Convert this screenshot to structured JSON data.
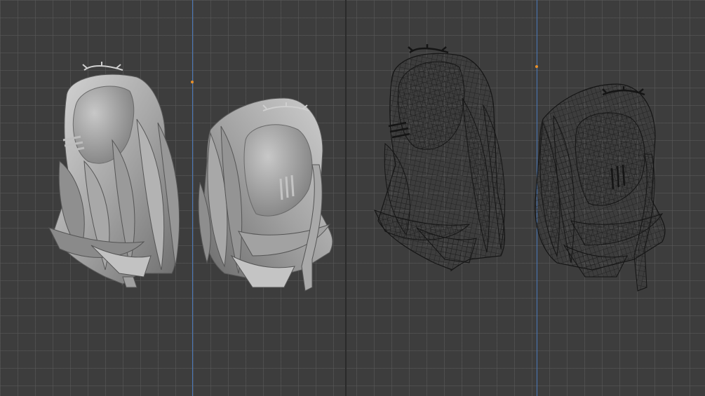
{
  "viewports": [
    {
      "name": "solid-shaded-view",
      "shading": "solid"
    },
    {
      "name": "wireframe-view",
      "shading": "wireframe"
    }
  ],
  "colors": {
    "background": "#3d3d3d",
    "grid": "#5a5a5a",
    "y_axis": "#4a78b8",
    "origin": "#e8902a",
    "solid_mesh": "#a9a9a9",
    "wire_mesh": "#1e1e1e"
  }
}
